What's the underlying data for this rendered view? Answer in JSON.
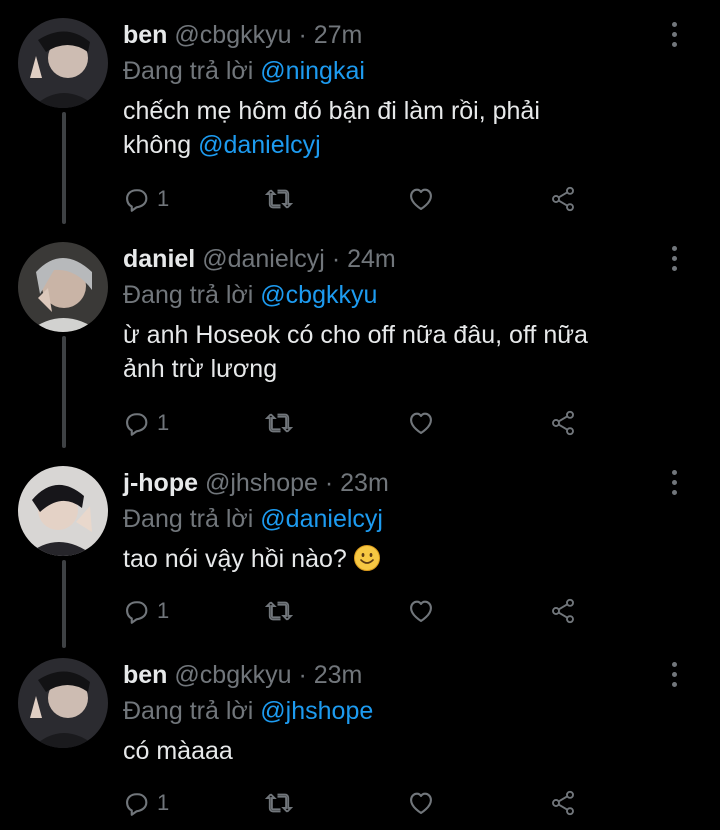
{
  "tweets": [
    {
      "name": "ben",
      "handle": "@cbgkkyu",
      "time": "· 27m",
      "reply_prefix": "Đang trả lời",
      "reply_to": "@ningkai",
      "text_1": "chếch mẹ hôm đó bận đi làm rồi, phải",
      "text_2": "không ",
      "mention": "@danielcyj",
      "reply_count": "1"
    },
    {
      "name": "daniel",
      "handle": "@danielcyj",
      "time": "· 24m",
      "reply_prefix": "Đang trả lời",
      "reply_to": "@cbgkkyu",
      "text_1": "ừ anh Hoseok có cho off nữa đâu, off nữa",
      "text_2": "ảnh trừ lương",
      "reply_count": "1"
    },
    {
      "name": "j-hope",
      "handle": "@jhshope",
      "time": "· 23m",
      "reply_prefix": "Đang trả lời",
      "reply_to": "@danielcyj",
      "text_1": "tao nói vậy hồi nào?",
      "reply_count": "1"
    },
    {
      "name": "ben",
      "handle": "@cbgkkyu",
      "time": "· 23m",
      "reply_prefix": "Đang trả lời",
      "reply_to": "@jhshope",
      "text_1": "có màaaa",
      "reply_count": "1"
    }
  ],
  "colors": {
    "background": "#000000",
    "text": "#e7e9ea",
    "muted": "#71767b",
    "mention": "#1d9bf0",
    "thread_line": "#3e4144"
  },
  "icons": [
    "reply-icon",
    "retweet-icon",
    "like-icon",
    "share-icon",
    "more-options-icon",
    "smile-emoji"
  ]
}
